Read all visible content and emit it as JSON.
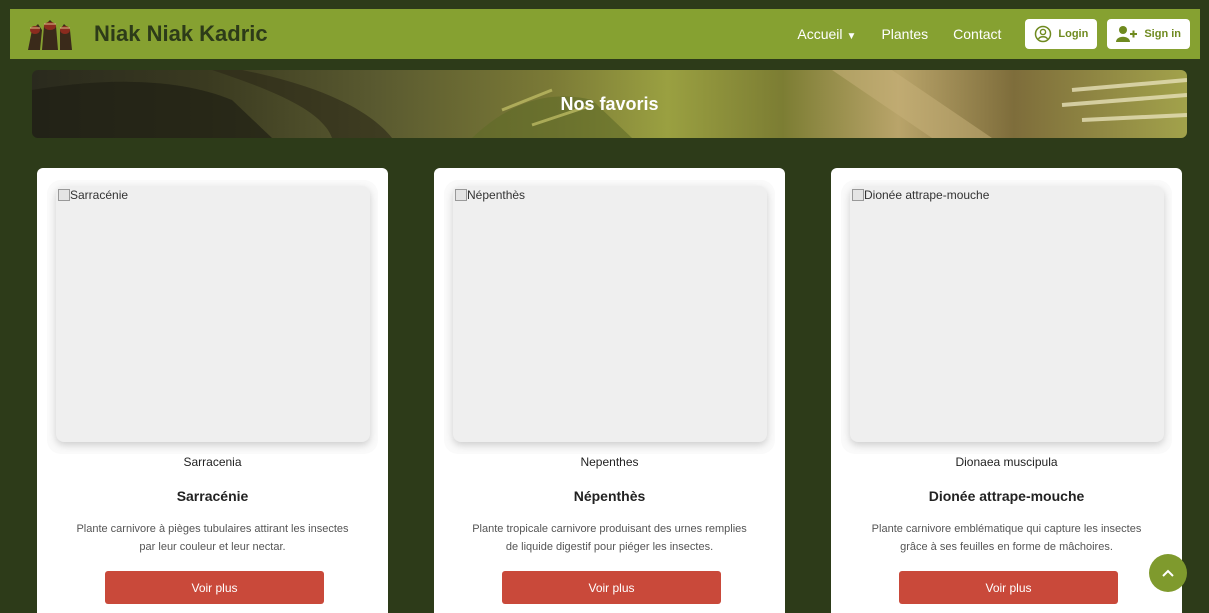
{
  "header": {
    "brand": "Niak Niak Kadric",
    "nav": [
      {
        "label": "Accueil",
        "has_caret": true
      },
      {
        "label": "Plantes"
      },
      {
        "label": "Contact"
      }
    ],
    "login_label": "Login",
    "signin_label": "Sign in",
    "colors": {
      "bar": "#86a131",
      "brand_text": "#2d3b19"
    }
  },
  "hero": {
    "title": "Nos favoris"
  },
  "cards": [
    {
      "img_alt": "Sarracénie",
      "latin": "Sarracenia",
      "name": "Sarracénie",
      "desc_line1": "Plante carnivore à pièges tubulaires attirant les insectes",
      "desc_line2": "par leur couleur et leur nectar.",
      "button": "Voir plus"
    },
    {
      "img_alt": "Népenthès",
      "latin": "Nepenthes",
      "name": "Népenthès",
      "desc_line1": "Plante tropicale carnivore produisant des urnes remplies",
      "desc_line2": "de liquide digestif pour piéger les insectes.",
      "button": "Voir plus"
    },
    {
      "img_alt": "Dionée attrape-mouche",
      "latin": "Dionaea muscipula",
      "name": "Dionée attrape-mouche",
      "desc_line1": "Plante carnivore emblématique qui capture les insectes",
      "desc_line2": "grâce à ses feuilles en forme de mâchoires.",
      "button": "Voir plus"
    }
  ],
  "icons": {
    "logo": "carnivorous-plant-logo",
    "login": "user-circle-icon",
    "signin": "user-plus-icon",
    "scroll_top": "chevron-up-icon"
  },
  "colors": {
    "page_bg": "#2d3b19",
    "accent_button": "#c9493a",
    "scroll_button": "#7f9a2d"
  }
}
